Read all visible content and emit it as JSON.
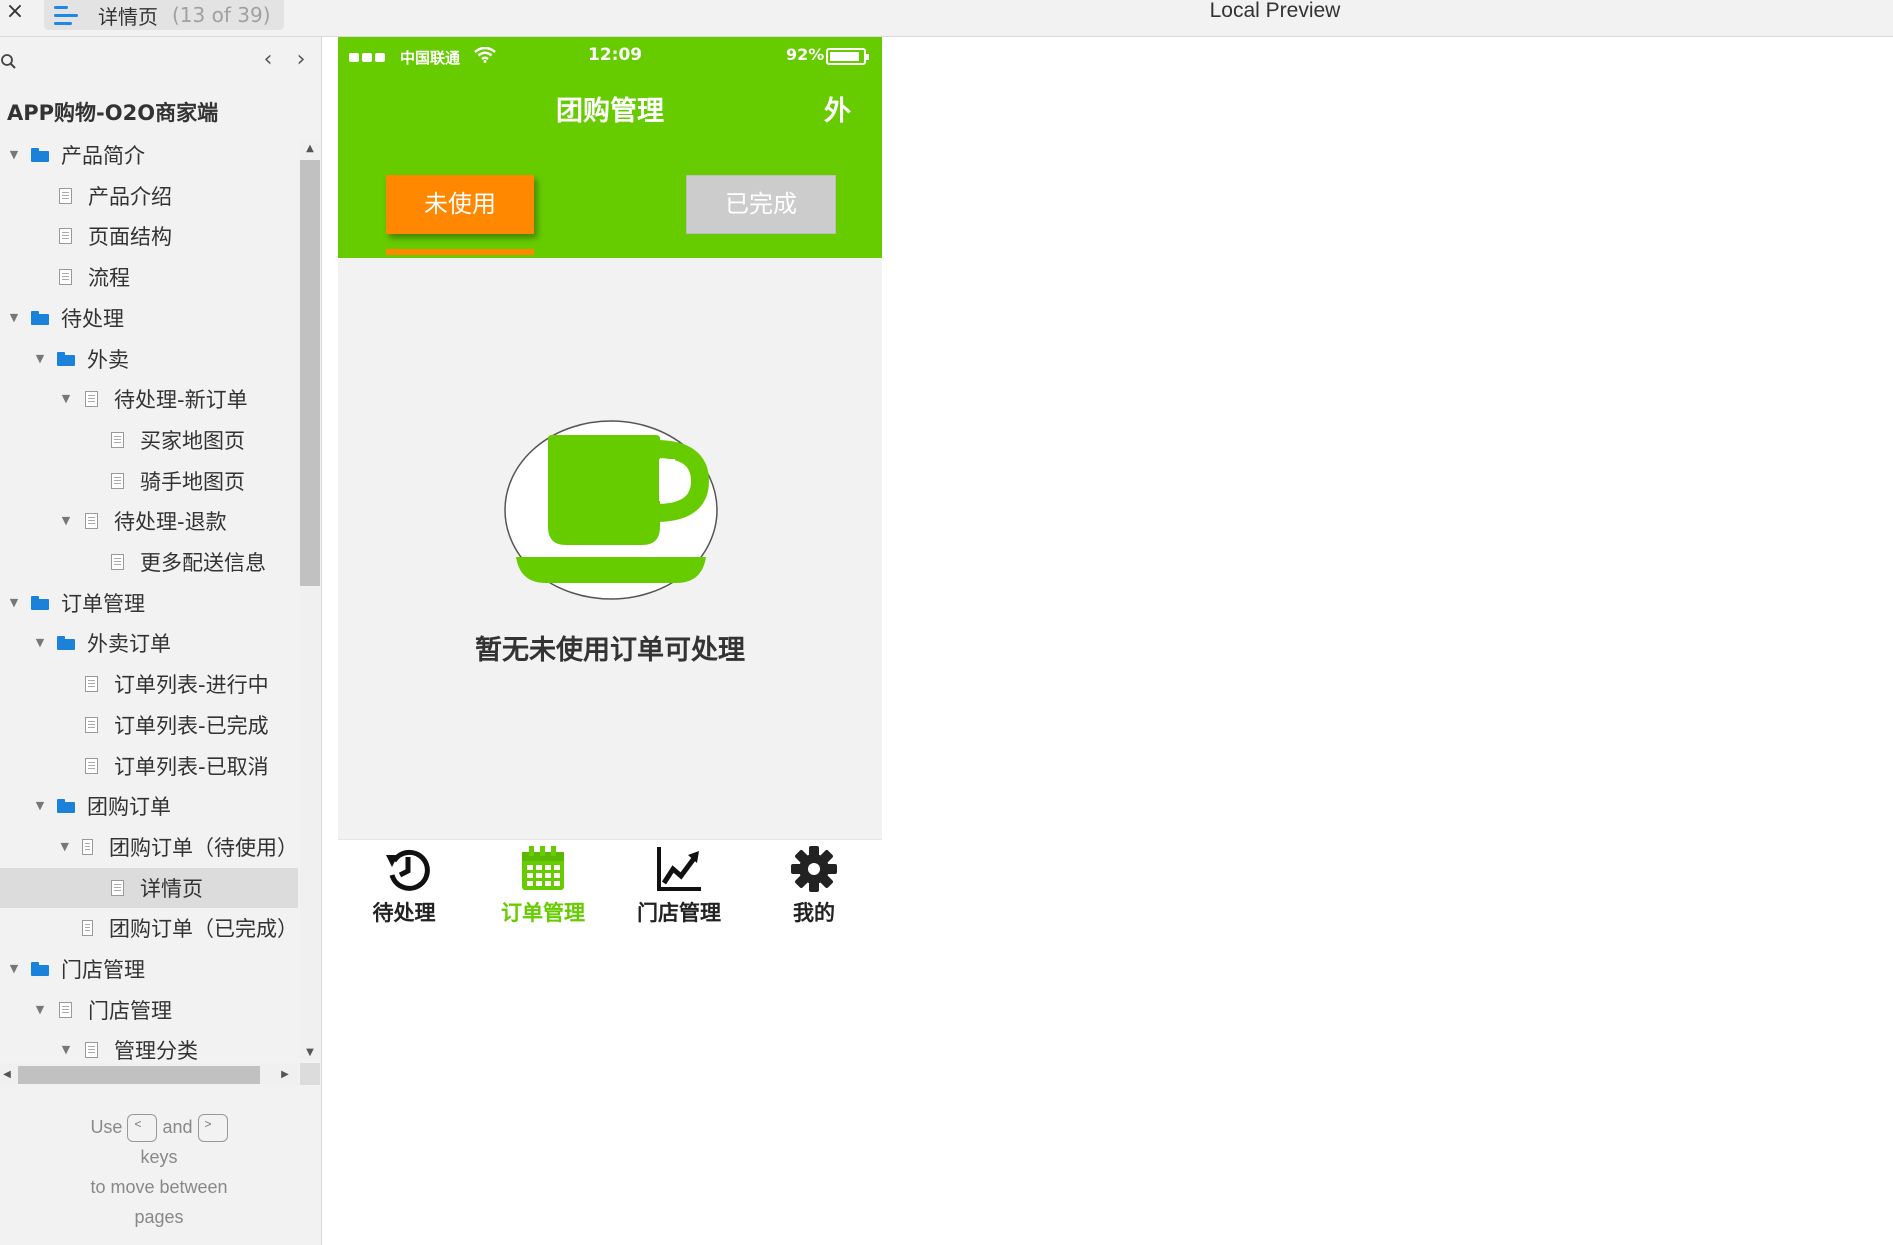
{
  "topbar": {
    "close_label": "×",
    "page_title": "详情页",
    "page_count": "(13 of 39)",
    "window_title": "Local Preview"
  },
  "sidebar": {
    "prev_label": "‹",
    "next_label": "›",
    "project_title": "APP购物-O2O商家端",
    "tree": [
      {
        "label": "产品简介",
        "type": "folder",
        "depth": 0,
        "expanded": true
      },
      {
        "label": "产品介绍",
        "type": "page",
        "depth": 1,
        "expanded": false
      },
      {
        "label": "页面结构",
        "type": "page",
        "depth": 1,
        "expanded": false
      },
      {
        "label": "流程",
        "type": "page",
        "depth": 1,
        "expanded": false
      },
      {
        "label": "待处理",
        "type": "folder",
        "depth": 0,
        "expanded": true
      },
      {
        "label": "外卖",
        "type": "folder",
        "depth": 1,
        "expanded": true
      },
      {
        "label": "待处理-新订单",
        "type": "page",
        "depth": 2,
        "expanded": true
      },
      {
        "label": "买家地图页",
        "type": "page",
        "depth": 3,
        "expanded": false
      },
      {
        "label": "骑手地图页",
        "type": "page",
        "depth": 3,
        "expanded": false
      },
      {
        "label": "待处理-退款",
        "type": "page",
        "depth": 2,
        "expanded": true
      },
      {
        "label": "更多配送信息",
        "type": "page",
        "depth": 3,
        "expanded": false
      },
      {
        "label": "订单管理",
        "type": "folder",
        "depth": 0,
        "expanded": true
      },
      {
        "label": "外卖订单",
        "type": "folder",
        "depth": 1,
        "expanded": true
      },
      {
        "label": "订单列表-进行中",
        "type": "page",
        "depth": 2,
        "expanded": false
      },
      {
        "label": "订单列表-已完成",
        "type": "page",
        "depth": 2,
        "expanded": false
      },
      {
        "label": "订单列表-已取消",
        "type": "page",
        "depth": 2,
        "expanded": false
      },
      {
        "label": "团购订单",
        "type": "folder",
        "depth": 1,
        "expanded": true
      },
      {
        "label": "团购订单（待使用）",
        "type": "page",
        "depth": 2,
        "expanded": true
      },
      {
        "label": "详情页",
        "type": "page",
        "depth": 3,
        "expanded": false,
        "selected": true
      },
      {
        "label": "团购订单（已完成）",
        "type": "page",
        "depth": 2,
        "expanded": false
      },
      {
        "label": "门店管理",
        "type": "folder",
        "depth": 0,
        "expanded": true
      },
      {
        "label": "门店管理",
        "type": "page",
        "depth": 1,
        "expanded": true
      },
      {
        "label": "管理分类",
        "type": "page",
        "depth": 2,
        "expanded": true
      }
    ],
    "hint": {
      "use": "Use",
      "key_prev": "<",
      "and": "and",
      "key_next": ">",
      "keys": "keys",
      "line2": "to move between",
      "line3": "pages"
    }
  },
  "phone": {
    "status_bar": {
      "carrier": "中国联通",
      "time": "12:09",
      "battery": "92%",
      "battery_level": 0.92
    },
    "title": "团购管理",
    "takeout_button": "外",
    "tabs": {
      "unused": "未使用",
      "done": "已完成"
    },
    "empty_message": "暂无未使用订单可处理",
    "colors": {
      "brand_green": "#66cc00",
      "active_orange": "#ff8800",
      "inactive_gray": "#cccccc"
    },
    "tabbar": [
      {
        "label": "待处理",
        "icon": "history-icon",
        "active": false
      },
      {
        "label": "订单管理",
        "icon": "calendar-icon",
        "active": true
      },
      {
        "label": "门店管理",
        "icon": "line-chart-icon",
        "active": false
      },
      {
        "label": "我的",
        "icon": "gear-icon",
        "active": false
      }
    ]
  }
}
